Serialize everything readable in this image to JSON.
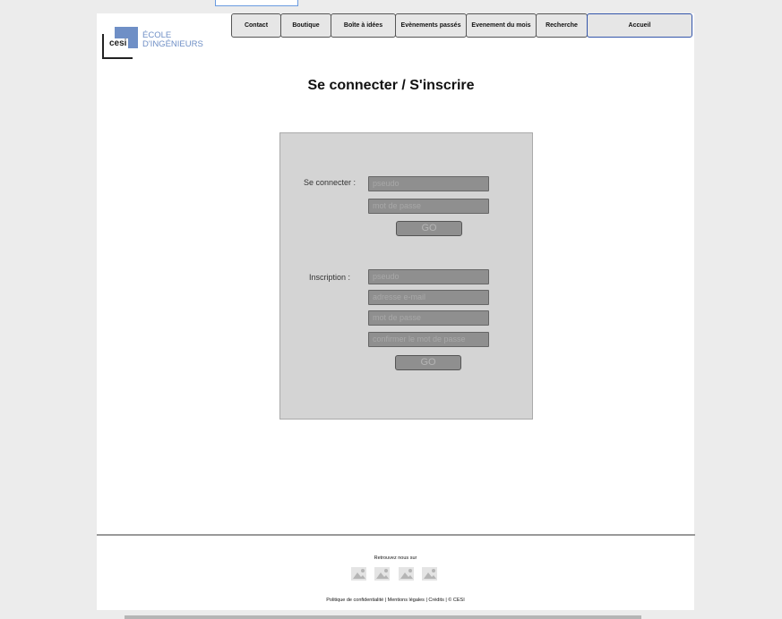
{
  "nav": [
    "Contact",
    "Boutique",
    "Boîte à idées",
    "Evènements passés",
    "Evenement du mois",
    "Recherche",
    "Accueil"
  ],
  "logo": {
    "brand": "cesi",
    "line1": "ÉCOLE",
    "line2": "D'INGÉNIEURS"
  },
  "title": "Se connecter / S'inscrire",
  "login": {
    "label": "Se connecter :",
    "pseudo": "pseudo",
    "password": "mot de passe",
    "go": "GO"
  },
  "signup": {
    "label": "Inscription :",
    "pseudo": "pseudo",
    "email": "adresse e-mail",
    "password": "mot de passe",
    "confirm": "confirmer le mot de passe",
    "go": "GO"
  },
  "footer": {
    "follow": "Retrouvez nous sur",
    "links": "Politique de confidentialité | Mentions légales | Crédits | © CESI"
  }
}
